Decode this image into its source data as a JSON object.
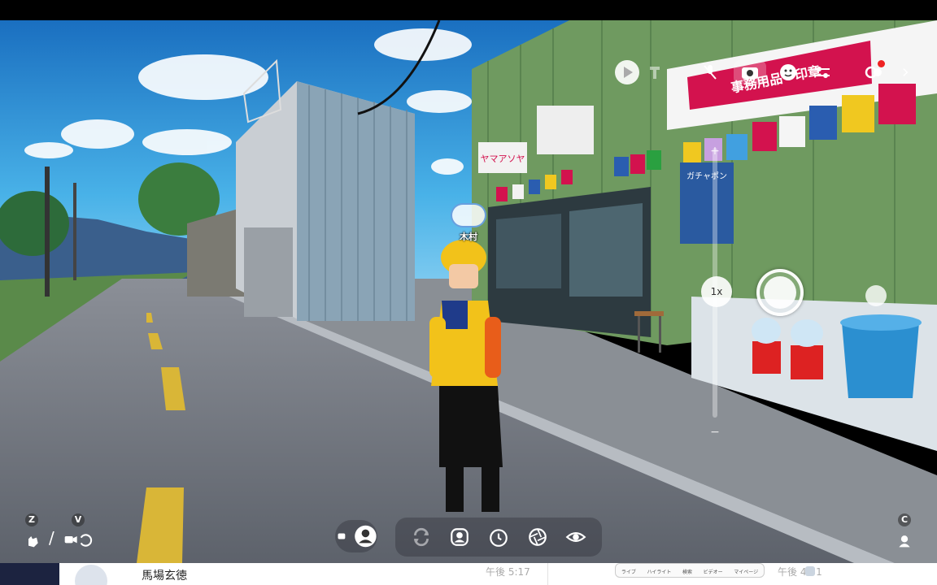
{
  "colors": {
    "sky": "#3aa0df",
    "road": "#6f7580",
    "accent_red": "#d3124e",
    "jacket_yellow": "#f2c21a"
  },
  "scene": {
    "shop_sign": "事務用品・印章",
    "small_sign": "ヤマアソヤ",
    "poster_text": "ガチャポン",
    "player_name": "木村"
  },
  "hud_top": {
    "icons": [
      "play-icon",
      "hammer-icon",
      "mic-off-icon",
      "camera-icon",
      "face-icon",
      "sliders-icon",
      "record-icon",
      "chevron-right-icon"
    ]
  },
  "camera_controls": {
    "zoom_plus": "+",
    "zoom_minus": "−",
    "zoom_level": "1x"
  },
  "key_hints": {
    "left1": "Z",
    "left2": "V",
    "right": "C"
  },
  "bottom_toolbar": {
    "icons": [
      "rotate-icon",
      "face-frame-icon",
      "timer-icon",
      "aperture-icon",
      "eye-icon"
    ]
  },
  "chat_strip": {
    "username": "馬場玄徳",
    "time1": "午後 5:17",
    "tabs": [
      "ライブ",
      "ハイライト",
      "検索",
      "ビデオー",
      "マイページ"
    ],
    "time2": "午後 4:51"
  }
}
